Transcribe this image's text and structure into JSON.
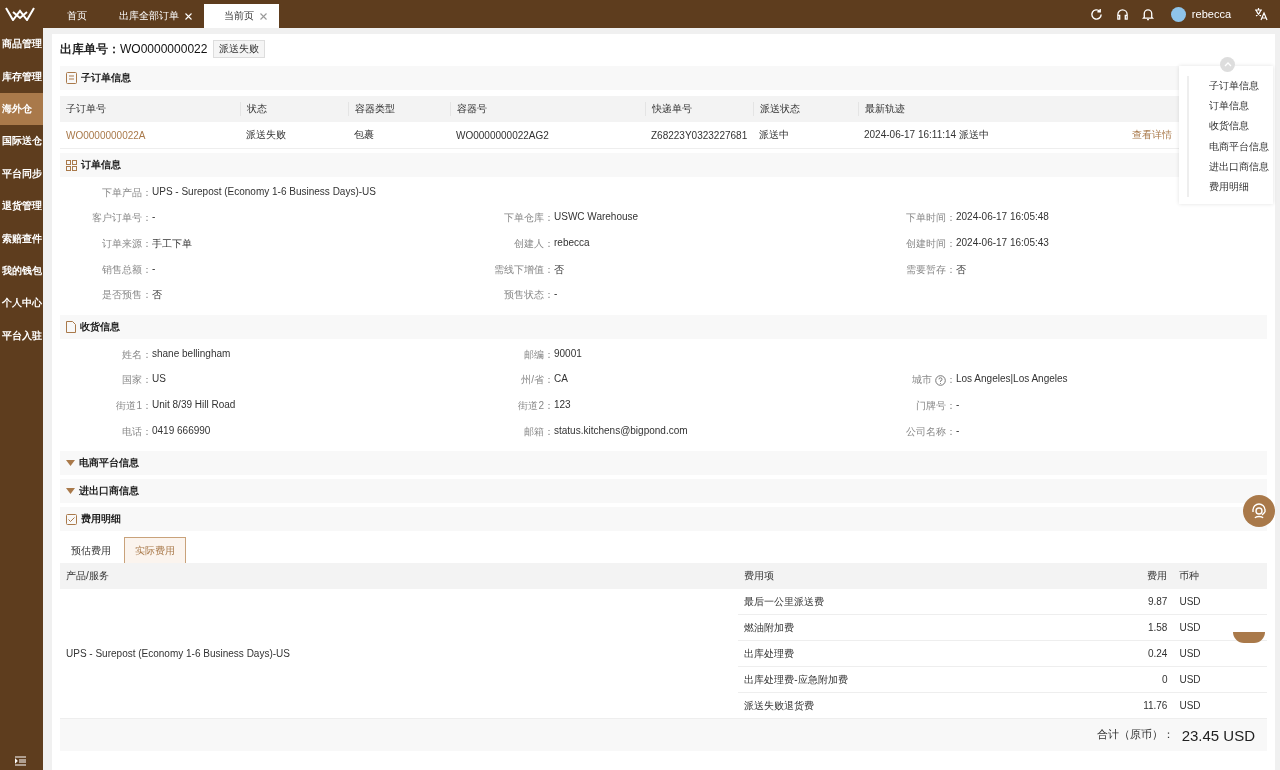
{
  "top_tabs": [
    {
      "label": "首页",
      "selected": false,
      "closable": false
    },
    {
      "label": "出库全部订单",
      "selected": false,
      "closable": true
    },
    {
      "label": "当前页",
      "selected": true,
      "closable": true
    }
  ],
  "user": {
    "name": "rebecca"
  },
  "sidebar": {
    "items": [
      {
        "label": "商品管理",
        "selected": false
      },
      {
        "label": "库存管理",
        "selected": false
      },
      {
        "label": "海外仓",
        "selected": true
      },
      {
        "label": "国际送仓",
        "selected": false
      },
      {
        "label": "平台同步",
        "selected": false
      },
      {
        "label": "退货管理",
        "selected": false
      },
      {
        "label": "索赔查件",
        "selected": false
      },
      {
        "label": "我的钱包",
        "selected": false
      },
      {
        "label": "个人中心",
        "selected": false
      },
      {
        "label": "平台入驻",
        "selected": false
      }
    ]
  },
  "header": {
    "label": "出库单号：",
    "order_no": "WO0000000022",
    "status": "派送失败"
  },
  "suborders": {
    "title": "子订单信息",
    "columns": [
      "子订单号",
      "状态",
      "容器类型",
      "容器号",
      "快递单号",
      "派送状态",
      "最新轨迹"
    ],
    "rows": [
      {
        "cells": [
          "WO0000000022A",
          "派送失败",
          "包裹",
          "WO0000000022AG2",
          "Z68223Y0323227681",
          "派送中",
          "2024-06-17 16:11:14 派送中"
        ],
        "action": "查看详情"
      }
    ]
  },
  "order_info": {
    "title": "订单信息",
    "rows": [
      [
        {
          "label": "下单产品：",
          "value": "UPS - Surepost (Economy 1-6 Business Days)-US"
        }
      ],
      [
        {
          "label": "客户订单号：",
          "value": "-"
        },
        {
          "label": "下单仓库：",
          "value": "USWC Warehouse"
        },
        {
          "label": "下单时间：",
          "value": "2024-06-17 16:05:48"
        }
      ],
      [
        {
          "label": "订单来源：",
          "value": "手工下单"
        },
        {
          "label": "创建人：",
          "value": "rebecca"
        },
        {
          "label": "创建时间：",
          "value": "2024-06-17 16:05:43"
        }
      ],
      [
        {
          "label": "销售总额：",
          "value": "-"
        },
        {
          "label": "需线下增值：",
          "value": "否"
        },
        {
          "label": "需要暂存：",
          "value": "否"
        }
      ],
      [
        {
          "label": "是否预售：",
          "value": "否"
        },
        {
          "label": "预售状态：",
          "value": "-"
        }
      ]
    ]
  },
  "address": {
    "title": "收货信息",
    "rows": [
      [
        {
          "label": "姓名：",
          "value": "shane bellingham"
        },
        {
          "label": "邮编：",
          "value": "90001"
        }
      ],
      [
        {
          "label": "国家：",
          "value": "US"
        },
        {
          "label": "州/省：",
          "value": "CA"
        },
        {
          "label": "城市",
          "value": "Los Angeles|Los Angeles",
          "help": true,
          "suffix": "："
        }
      ],
      [
        {
          "label": "街道1：",
          "value": "Unit 8/39 Hill Road"
        },
        {
          "label": "街道2：",
          "value": "123"
        },
        {
          "label": "门牌号：",
          "value": "-"
        }
      ],
      [
        {
          "label": "电话：",
          "value": "0419 666990"
        },
        {
          "label": "邮箱：",
          "value": "status.kitchens@bigpond.com"
        },
        {
          "label": "公司名称：",
          "value": "-"
        }
      ]
    ]
  },
  "collapsed_sections": [
    "电商平台信息",
    "进出口商信息"
  ],
  "fees": {
    "title": "费用明细",
    "tabs": [
      {
        "label": "预估费用",
        "selected": false
      },
      {
        "label": "实际费用",
        "selected": true
      }
    ],
    "columns": [
      "产品/服务",
      "费用项",
      "费用",
      "币种"
    ],
    "product": "UPS - Surepost (Economy 1-6 Business Days)-US",
    "items": [
      {
        "name": "最后一公里派送费",
        "amount": "9.87",
        "currency": "USD"
      },
      {
        "name": "燃油附加费",
        "amount": "1.58",
        "currency": "USD"
      },
      {
        "name": "出库处理费",
        "amount": "0.24",
        "currency": "USD"
      },
      {
        "name": "出库处理费-应急附加费",
        "amount": "0",
        "currency": "USD"
      },
      {
        "name": "派送失败退货费",
        "amount": "11.76",
        "currency": "USD"
      }
    ],
    "total_label": "合计（原币）：",
    "total": "23.45 USD"
  },
  "anchor_nav": [
    "子订单信息",
    "订单信息",
    "收货信息",
    "电商平台信息",
    "进出口商信息",
    "费用明细"
  ]
}
